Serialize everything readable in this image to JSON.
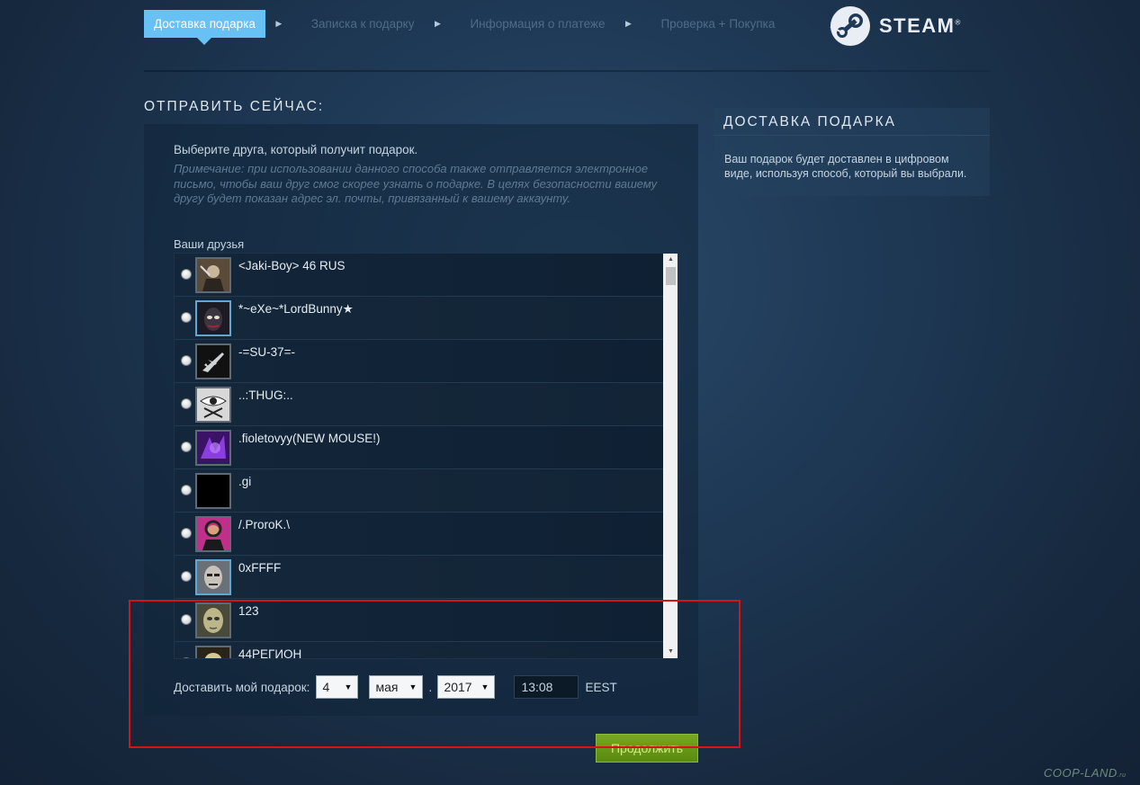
{
  "steps": [
    {
      "label": "Доставка подарка",
      "active": true
    },
    {
      "label": "Записка к подарку",
      "active": false
    },
    {
      "label": "Информация о платеже",
      "active": false
    },
    {
      "label": "Проверка + Покупка",
      "active": false
    }
  ],
  "logo": {
    "text": "STEAM",
    "mark": "®"
  },
  "main": {
    "section_title": "ОТПРАВИТЬ СЕЙЧАС:",
    "instruction": "Выберите друга, который получит подарок.",
    "note": "Примечание: при использовании данного способа также отправляется электронное письмо, чтобы ваш друг смог скорее узнать о подарке. В целях безопасности вашему другу будет показан адрес эл. почты, привязанный к вашему аккаунту.",
    "friends_label": "Ваши друзья",
    "friends": [
      {
        "name": "<Jaki-Boy> 46 RUS",
        "avatar": "warrior-avatar",
        "online": false
      },
      {
        "name": "*~eXe~*LordBunny★",
        "avatar": "masked-face-avatar",
        "online": true
      },
      {
        "name": "-=SU-37=-",
        "avatar": "jet-fighter-avatar",
        "online": false
      },
      {
        "name": "..:THUG:..",
        "avatar": "eye-symbol-avatar",
        "online": false
      },
      {
        "name": ".fioletovyy(NEW MOUSE!)",
        "avatar": "purple-abstract-avatar",
        "online": false
      },
      {
        "name": ".gi",
        "avatar": "black-square-avatar",
        "online": false
      },
      {
        "name": "/.ProroK.\\",
        "avatar": "pink-portrait-avatar",
        "online": false
      },
      {
        "name": "0xFFFF",
        "avatar": "face-portrait-avatar",
        "online": true
      },
      {
        "name": "123",
        "avatar": "alien-face-avatar",
        "online": false
      },
      {
        "name": "44РЕГИОН",
        "avatar": "skull-avatar",
        "online": false
      }
    ],
    "deliver": {
      "label": "Доставить мой подарок:",
      "day": "4",
      "month": "мая",
      "year": "2017",
      "time": "13:08",
      "timezone": "EEST"
    },
    "continue_label": "Продолжить"
  },
  "sidebar": {
    "title": "ДОСТАВКА ПОДАРКА",
    "text": "Ваш подарок будет доставлен в цифровом виде, используя способ, который вы выбрали."
  },
  "watermark": {
    "text": "COOP-LAND",
    "suffix": ".ru"
  },
  "colors": {
    "accent": "#67c1f5",
    "highlight": "#d01616",
    "button": "#6a9a16"
  }
}
